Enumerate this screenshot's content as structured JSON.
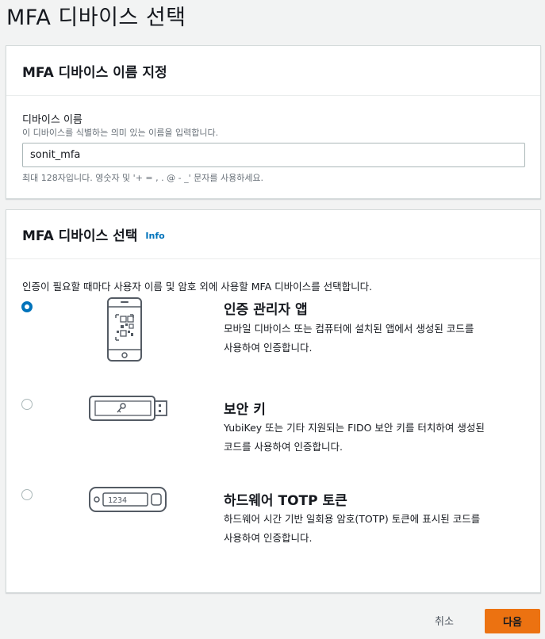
{
  "page": {
    "title": "MFA 디바이스 선택"
  },
  "device_name_section": {
    "heading": "MFA 디바이스 이름 지정",
    "field_label": "디바이스 이름",
    "field_description": "이 디바이스를 식별하는 의미 있는 이름을 입력합니다.",
    "field_value": "sonit_mfa",
    "constraint_text": "최대 128자입니다. 영숫자 및 '+ = , . @ - _' 문자를 사용하세요."
  },
  "device_select_section": {
    "heading": "MFA 디바이스 선택",
    "info_label": "Info",
    "description": "인증이 필요할 때마다 사용자 이름 및 암호 외에 사용할 MFA 디바이스를 선택합니다.",
    "options": [
      {
        "title": "인증 관리자 앱",
        "desc_line1": "모바일 디바이스 또는 컴퓨터에 설치된 앱에서 생성된 코드를",
        "desc_line2": "사용하여 인증합니다.",
        "selected": true,
        "icon": "phone-qr-icon"
      },
      {
        "title": "보안 키",
        "desc_line1": "YubiKey 또는 기타 지원되는 FIDO 보안 키를 터치하여 생성된",
        "desc_line2": "코드를 사용하여 인증합니다.",
        "selected": false,
        "icon": "usb-key-icon"
      },
      {
        "title": "하드웨어 TOTP 토큰",
        "desc_line1": "하드웨어 시간 기반 일회용 암호(TOTP) 토큰에 표시된 코드를",
        "desc_line2": "사용하여 인증합니다.",
        "selected": false,
        "icon": "totp-token-icon",
        "token_display": "1234"
      }
    ]
  },
  "footer": {
    "cancel_label": "취소",
    "next_label": "다음"
  },
  "colors": {
    "primary": "#ec7211",
    "link": "#0073bb",
    "background": "#f2f3f3"
  }
}
